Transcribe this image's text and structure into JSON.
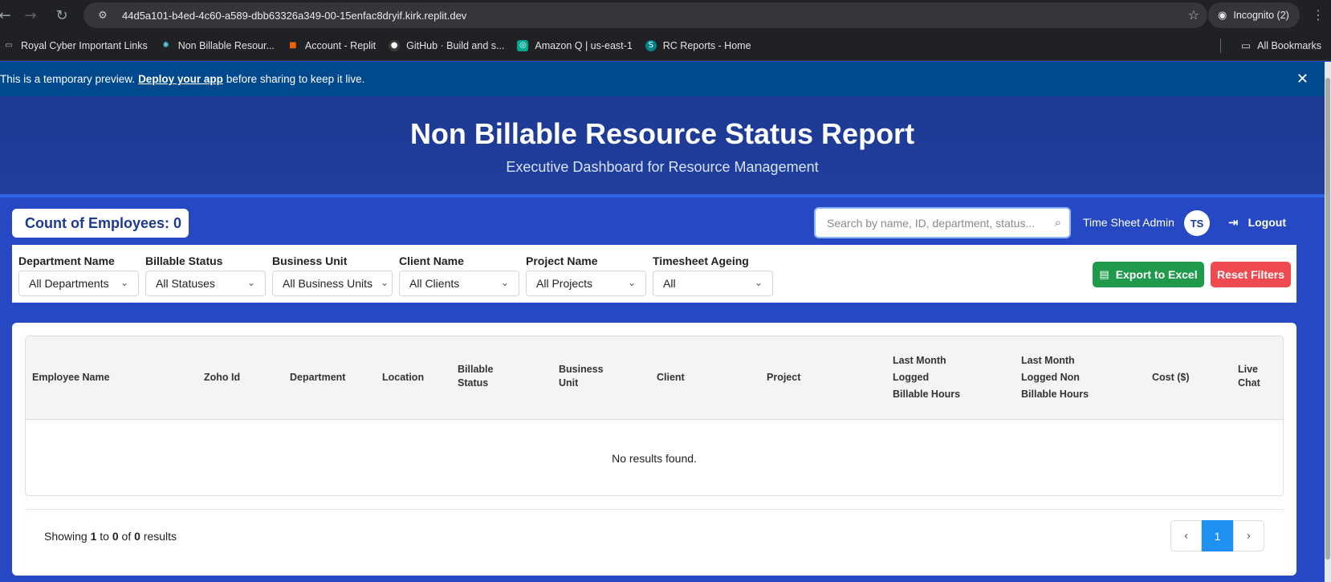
{
  "browser": {
    "url": "44d5a101-b4ed-4c60-a589-dbb63326a349-00-15enfac8dryif.kirk.replit.dev",
    "incognito_label": "Incognito (2)",
    "bookmarks": [
      {
        "label": "Royal Cyber Important Links",
        "icon": "folder-icon",
        "color": "#9aa0a6"
      },
      {
        "label": "Non Billable Resour...",
        "icon": "react-icon",
        "color": "#5ec8e6"
      },
      {
        "label": "Account - Replit",
        "icon": "replit-icon",
        "color": "#f26207"
      },
      {
        "label": "GitHub · Build and s...",
        "icon": "github-icon",
        "color": "#6e7681"
      },
      {
        "label": "Amazon Q | us-east-1",
        "icon": "amazon-q-icon",
        "color": "#01a88d"
      },
      {
        "label": "RC Reports - Home",
        "icon": "sharepoint-icon",
        "color": "#038387"
      }
    ],
    "all_bookmarks_label": "All Bookmarks"
  },
  "banner": {
    "text_before": "This is a temporary preview.",
    "link_text": "Deploy your app",
    "text_after": "before sharing to keep it live."
  },
  "header": {
    "title": "Non Billable Resource Status Report",
    "subtitle": "Executive Dashboard for Resource Management"
  },
  "toolbar": {
    "count_label": "Count of Employees: 0",
    "search_placeholder": "Search by name, ID, department, status...",
    "user_name": "Time Sheet Admin",
    "avatar_initials": "TS",
    "logout_label": "Logout"
  },
  "filters": [
    {
      "label": "Department Name",
      "value": "All Departments"
    },
    {
      "label": "Billable Status",
      "value": "All Statuses"
    },
    {
      "label": "Business Unit",
      "value": "All Business Units"
    },
    {
      "label": "Client Name",
      "value": "All Clients"
    },
    {
      "label": "Project Name",
      "value": "All Projects"
    },
    {
      "label": "Timesheet Ageing",
      "value": "All"
    }
  ],
  "actions": {
    "export_label": "Export to Excel",
    "reset_label": "Reset Filters"
  },
  "table": {
    "columns": [
      [
        "Employee Name"
      ],
      [
        "Zoho Id"
      ],
      [
        "Department"
      ],
      [
        "Location"
      ],
      [
        "Billable",
        "Status"
      ],
      [
        "Business",
        "Unit"
      ],
      [
        "Client"
      ],
      [
        "Project"
      ],
      [
        "Last Month",
        "Logged",
        "Billable Hours"
      ],
      [
        "Last Month",
        "Logged Non",
        "Billable Hours"
      ],
      [
        "Cost ($)"
      ],
      [
        "Live",
        "Chat"
      ]
    ],
    "rows": [],
    "empty_message": "No results found."
  },
  "pagination": {
    "showing_prefix": "Showing",
    "from": "1",
    "to_word": "to",
    "to": "0",
    "of_word": "of",
    "total": "0",
    "results_word": "results",
    "current_page": "1"
  },
  "colors": {
    "header_bg": "#1d3a92",
    "page_bg": "#2648c2",
    "export_green": "#1f9a4a",
    "reset_red": "#ef4a4f",
    "active_page_blue": "#1e90f0"
  }
}
